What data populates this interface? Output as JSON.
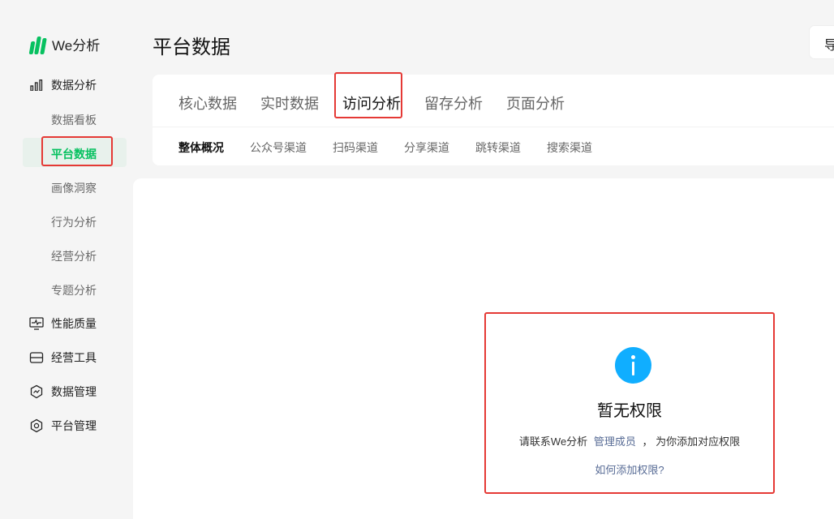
{
  "app": {
    "logo_text": "We分析"
  },
  "colors": {
    "brand": "#07c160",
    "link": "#576b95",
    "info": "#10aeff",
    "highlight": "#e53935"
  },
  "sidebar": {
    "groups": [
      {
        "label": "数据分析",
        "icon": "bar-chart-icon"
      },
      {
        "label": "性能质量",
        "icon": "monitor-icon"
      },
      {
        "label": "经营工具",
        "icon": "toolbox-icon"
      },
      {
        "label": "数据管理",
        "icon": "shield-chart-icon"
      },
      {
        "label": "平台管理",
        "icon": "hexagon-gear-icon"
      }
    ],
    "sub_items": [
      {
        "label": "数据看板"
      },
      {
        "label": "平台数据",
        "active": true
      },
      {
        "label": "画像洞察"
      },
      {
        "label": "行为分析"
      },
      {
        "label": "经营分析"
      },
      {
        "label": "专题分析"
      }
    ]
  },
  "header": {
    "title": "平台数据",
    "top_button_glyph": "导"
  },
  "tabs": [
    {
      "label": "核心数据"
    },
    {
      "label": "实时数据"
    },
    {
      "label": "访问分析",
      "active": true
    },
    {
      "label": "留存分析"
    },
    {
      "label": "页面分析"
    }
  ],
  "subtabs": [
    {
      "label": "整体概况",
      "active": true
    },
    {
      "label": "公众号渠道"
    },
    {
      "label": "扫码渠道"
    },
    {
      "label": "分享渠道"
    },
    {
      "label": "跳转渠道"
    },
    {
      "label": "搜索渠道"
    }
  ],
  "no_permission": {
    "icon": "info-icon",
    "title": "暂无权限",
    "desc_prefix": "请联系We分析",
    "desc_link": "管理成员",
    "desc_suffix": "， 为你添加对应权限",
    "help_link": "如何添加权限?"
  }
}
